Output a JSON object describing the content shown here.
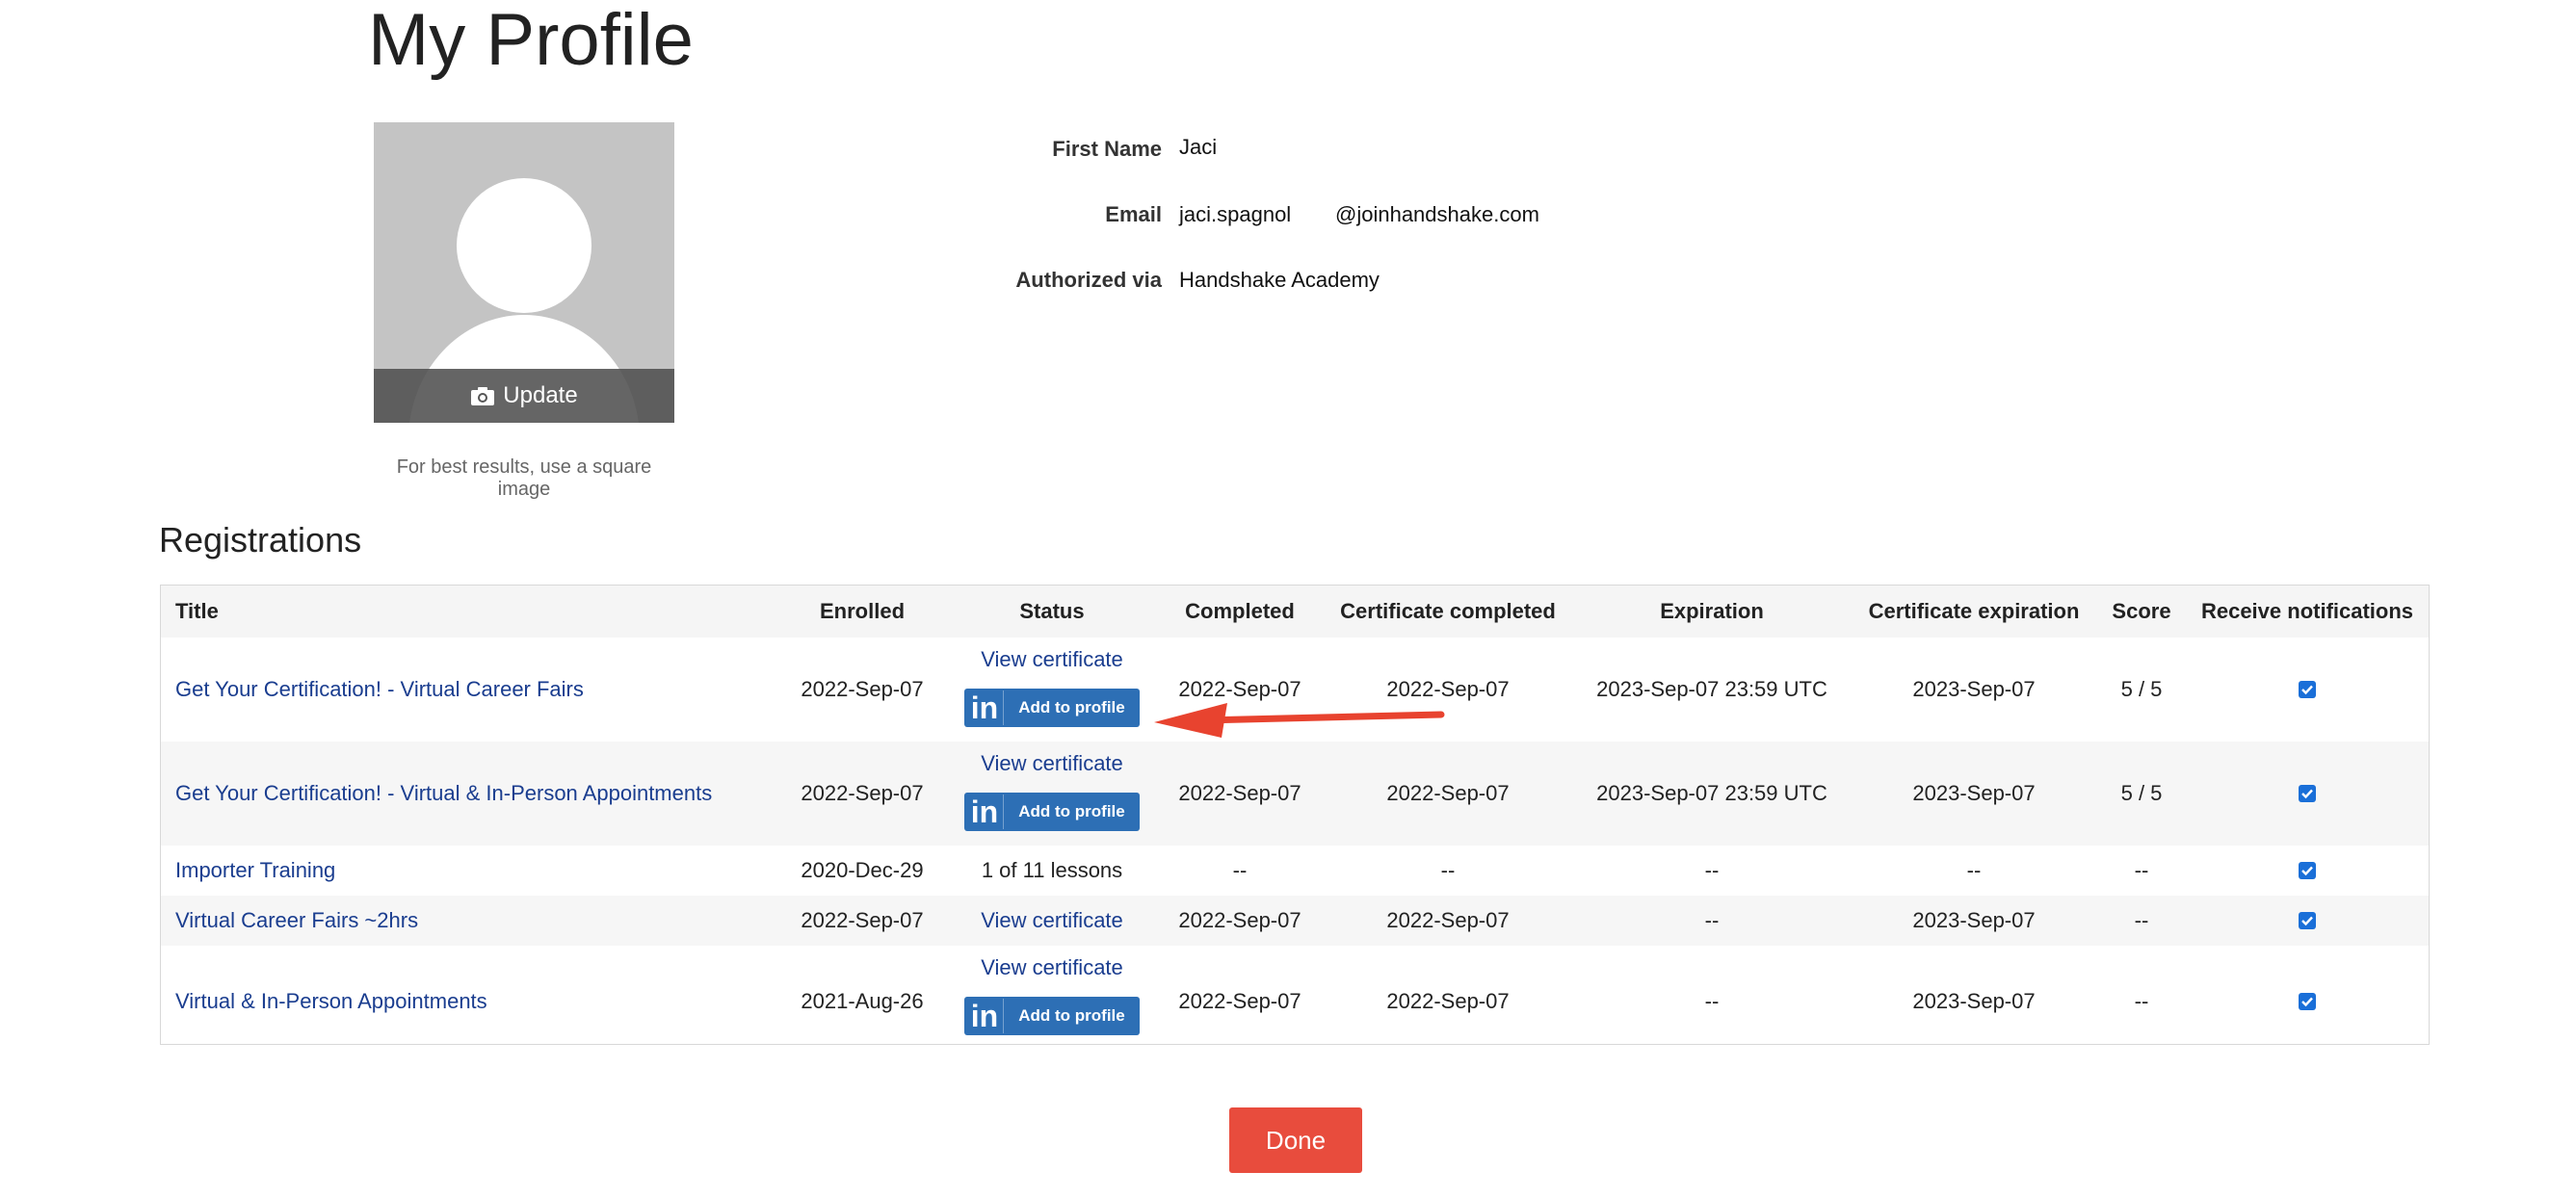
{
  "page": {
    "title": "My Profile"
  },
  "avatar": {
    "update_label": "Update",
    "hint": "For best results, use a square image"
  },
  "profile": {
    "first_name_label": "First Name",
    "first_name": "Jaci",
    "email_label": "Email",
    "email_user": "jaci.spagnol",
    "email_domain": "@joinhandshake.com",
    "authorized_label": "Authorized via",
    "authorized": "Handshake Academy"
  },
  "registrations": {
    "title": "Registrations",
    "headers": {
      "title": "Title",
      "enrolled": "Enrolled",
      "status": "Status",
      "completed": "Completed",
      "cert_completed": "Certificate completed",
      "expiration": "Expiration",
      "cert_expiration": "Certificate expiration",
      "score": "Score",
      "notifications": "Receive notifications"
    },
    "view_certificate": "View certificate",
    "add_to_profile": "Add to profile",
    "linkedin_logo": "in",
    "rows": [
      {
        "title": "Get Your Certification! - Virtual Career Fairs",
        "enrolled": "2022-Sep-07",
        "completed": "2022-Sep-07",
        "cert_completed": "2022-Sep-07",
        "expiration": "2023-Sep-07 23:59 UTC",
        "cert_expiration": "2023-Sep-07",
        "score": "5 / 5",
        "notify": true
      },
      {
        "title": "Get Your Certification! - Virtual & In-Person Appointments",
        "enrolled": "2022-Sep-07",
        "completed": "2022-Sep-07",
        "cert_completed": "2022-Sep-07",
        "expiration": "2023-Sep-07 23:59 UTC",
        "cert_expiration": "2023-Sep-07",
        "score": "5 / 5",
        "notify": true
      },
      {
        "title": "Importer Training",
        "enrolled": "2020-Dec-29",
        "status": "1 of 11 lessons",
        "completed": "--",
        "cert_completed": "--",
        "expiration": "--",
        "cert_expiration": "--",
        "score": "--",
        "notify": true
      },
      {
        "title": "Virtual Career Fairs ~2hrs",
        "enrolled": "2022-Sep-07",
        "completed": "2022-Sep-07",
        "cert_completed": "2022-Sep-07",
        "expiration": "--",
        "cert_expiration": "2023-Sep-07",
        "score": "--",
        "notify": true
      },
      {
        "title": "Virtual & In-Person Appointments",
        "enrolled": "2021-Aug-26",
        "completed": "2022-Sep-07",
        "cert_completed": "2022-Sep-07",
        "expiration": "--",
        "cert_expiration": "2023-Sep-07",
        "score": "--",
        "notify": true
      }
    ]
  },
  "actions": {
    "done_label": "Done"
  },
  "colors": {
    "link": "#1a3d8f",
    "linkedin": "#2d6fb5",
    "done": "#e84c3d",
    "arrow": "#e8432f",
    "checkbox": "#1a6fd8"
  },
  "icons": {
    "camera": "camera-icon",
    "linkedin": "linkedin-icon",
    "check": "check-icon",
    "arrow": "annotation-arrow"
  }
}
